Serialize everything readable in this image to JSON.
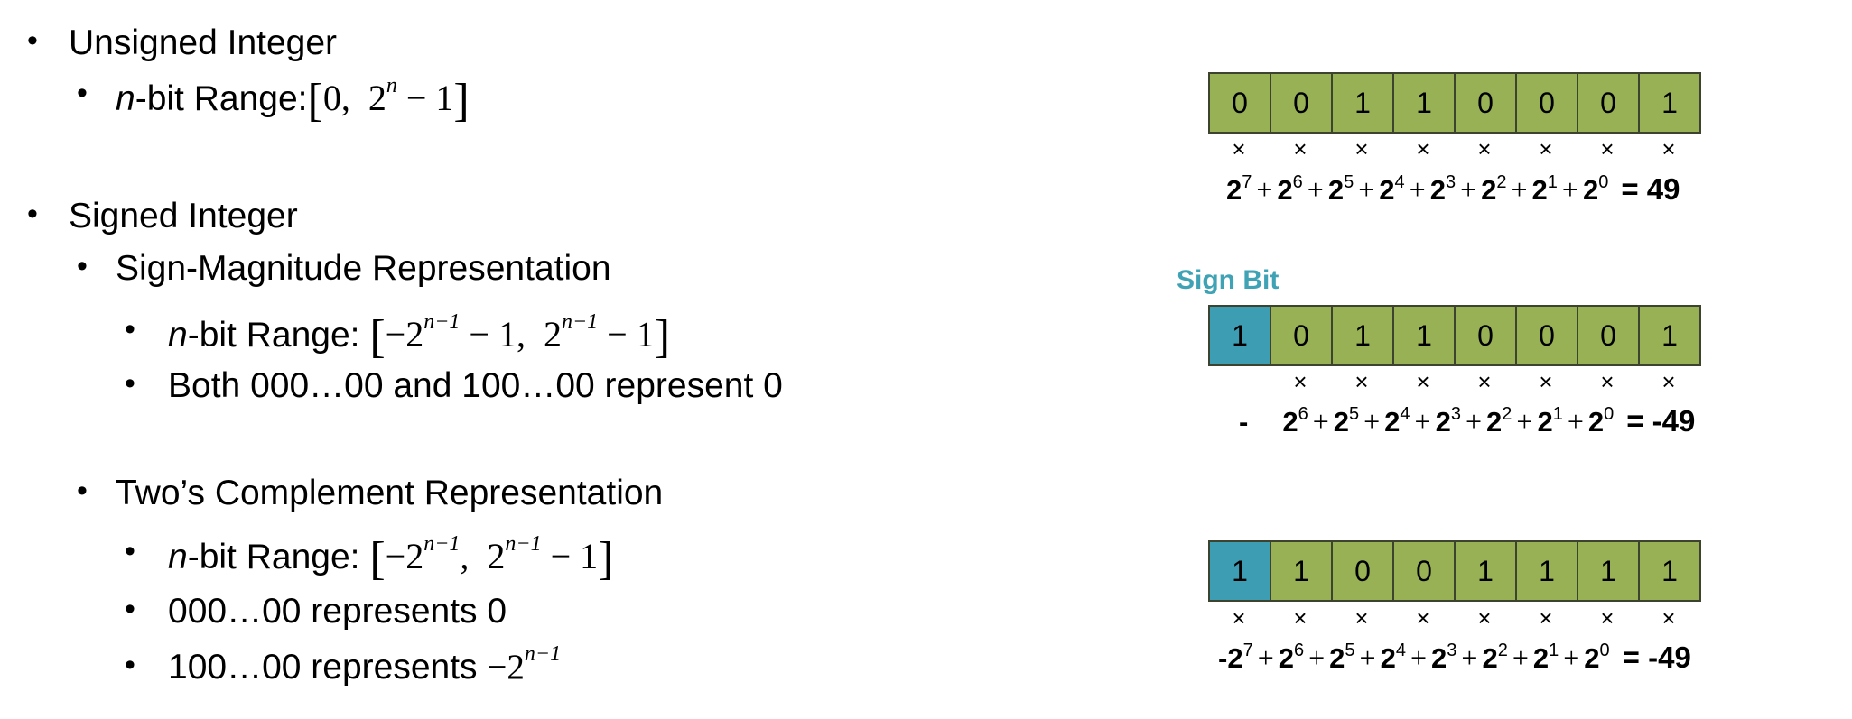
{
  "bullets": {
    "unsigned": {
      "title": "Unsigned Integer",
      "range_label": "n-bit Range:",
      "range": {
        "open": "[",
        "lower": "0,",
        "upper_base": "2",
        "upper_exp": "n",
        "upper_tail": "− 1",
        "close": "]"
      }
    },
    "signed": {
      "title": "Signed Integer"
    },
    "sign_magnitude": {
      "title": "Sign-Magnitude Representation",
      "range_label": "n-bit Range:",
      "range": {
        "open": "[",
        "lower_base": "−2",
        "lower_exp": "n−1",
        "lower_tail": "− 1,",
        "upper_base": "2",
        "upper_exp": "n−1",
        "upper_tail": "− 1",
        "close": "]"
      },
      "note": "Both 000…00 and 100…00 represent 0"
    },
    "twos_complement": {
      "title": "Two’s Complement Representation",
      "range_label": "n-bit Range:",
      "range": {
        "open": "[",
        "lower_base": "−2",
        "lower_exp": "n−1",
        "lower_tail": ",",
        "upper_base": "2",
        "upper_exp": "n−1",
        "upper_tail": "− 1",
        "close": "]"
      },
      "note_zero": "000…00 represents 0",
      "note_min_text": "100…00 represents",
      "note_min_base": "−2",
      "note_min_exp": "n−1"
    }
  },
  "bullet_char": "•",
  "n_label": "n",
  "sign_bit_label": "Sign Bit",
  "colors": {
    "green": "#97b154",
    "teal": "#3d9db3",
    "sign_label": "#3fa3b5"
  },
  "times_char": "×",
  "diagrams": [
    {
      "bits": [
        "0",
        "0",
        "1",
        "1",
        "0",
        "0",
        "0",
        "1"
      ],
      "sign_bit": false,
      "times_count": 8,
      "lead": "",
      "terms": [
        {
          "p": "",
          "e": "7"
        },
        {
          "p": "",
          "e": "6"
        },
        {
          "p": "",
          "e": "5"
        },
        {
          "p": "",
          "e": "4"
        },
        {
          "p": "",
          "e": "3"
        },
        {
          "p": "",
          "e": "2"
        },
        {
          "p": "",
          "e": "1"
        },
        {
          "p": "",
          "e": "0"
        }
      ],
      "result": "= 49"
    },
    {
      "bits": [
        "1",
        "0",
        "1",
        "1",
        "0",
        "0",
        "0",
        "1"
      ],
      "sign_bit": true,
      "times_count": 7,
      "lead": "-",
      "terms": [
        {
          "p": "",
          "e": "6"
        },
        {
          "p": "",
          "e": "5"
        },
        {
          "p": "",
          "e": "4"
        },
        {
          "p": "",
          "e": "3"
        },
        {
          "p": "",
          "e": "2"
        },
        {
          "p": "",
          "e": "1"
        },
        {
          "p": "",
          "e": "0"
        }
      ],
      "result": "= -49"
    },
    {
      "bits": [
        "1",
        "1",
        "0",
        "0",
        "1",
        "1",
        "1",
        "1"
      ],
      "sign_bit": true,
      "times_count": 8,
      "lead": "",
      "terms": [
        {
          "p": "-",
          "e": "7"
        },
        {
          "p": "",
          "e": "6"
        },
        {
          "p": "",
          "e": "5"
        },
        {
          "p": "",
          "e": "4"
        },
        {
          "p": "",
          "e": "3"
        },
        {
          "p": "",
          "e": "2"
        },
        {
          "p": "",
          "e": "1"
        },
        {
          "p": "",
          "e": "0"
        }
      ],
      "result": "= -49"
    }
  ],
  "term_base": "2",
  "plus": "+"
}
